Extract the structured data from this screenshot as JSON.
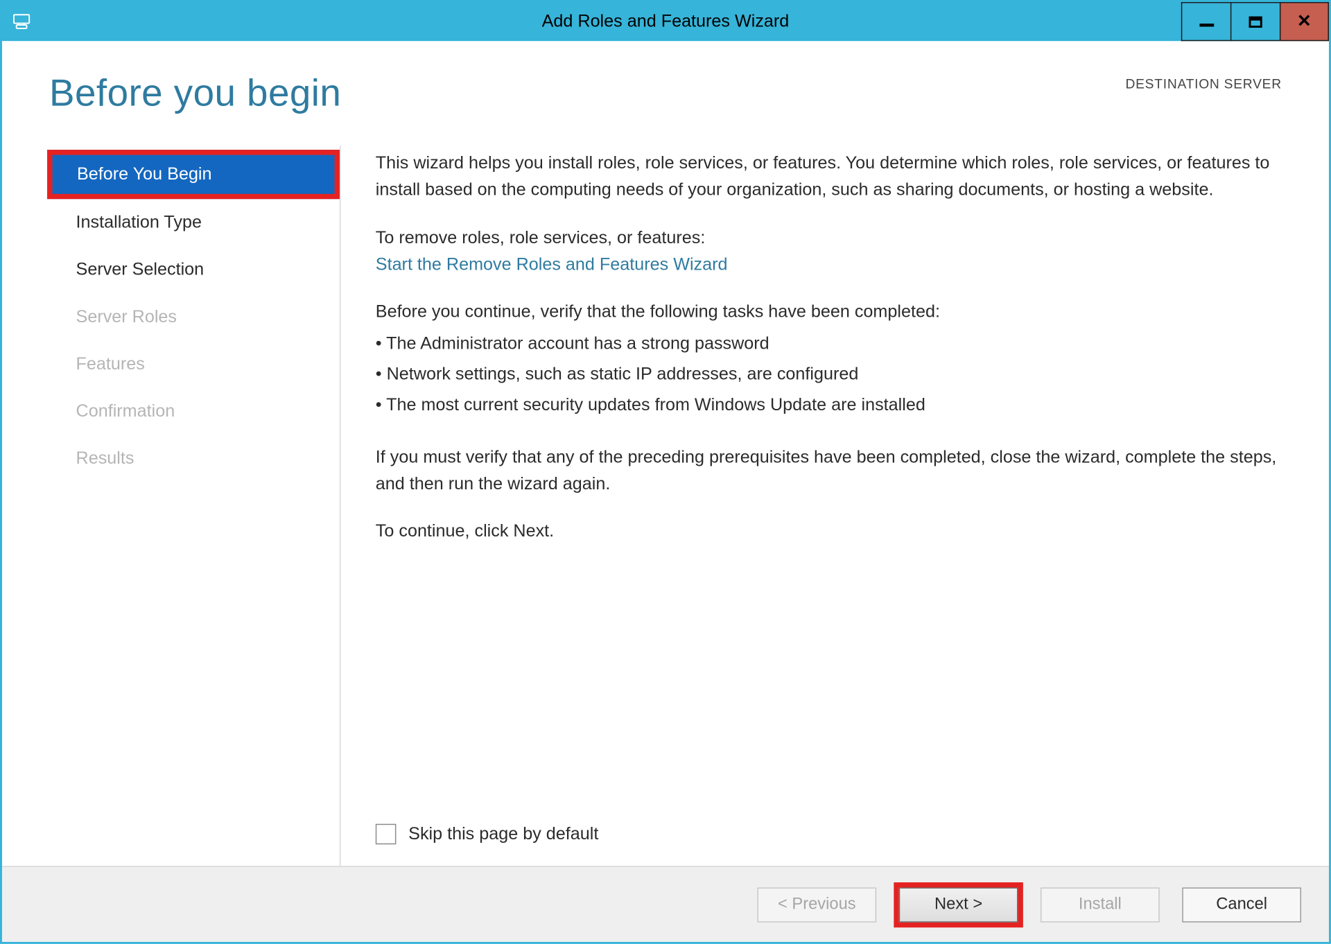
{
  "window": {
    "title": "Add Roles and Features Wizard"
  },
  "header": {
    "page_title": "Before you begin",
    "destination_label": "DESTINATION SERVER",
    "destination_name": " "
  },
  "sidebar": {
    "items": [
      {
        "label": "Before You Begin",
        "state": "selected"
      },
      {
        "label": "Installation Type",
        "state": "enabled"
      },
      {
        "label": "Server Selection",
        "state": "enabled"
      },
      {
        "label": "Server Roles",
        "state": "disabled"
      },
      {
        "label": "Features",
        "state": "disabled"
      },
      {
        "label": "Confirmation",
        "state": "disabled"
      },
      {
        "label": "Results",
        "state": "disabled"
      }
    ]
  },
  "content": {
    "intro": "This wizard helps you install roles, role services, or features. You determine which roles, role services, or features to install based on the computing needs of your organization, such as sharing documents, or hosting a website.",
    "remove_prompt": "To remove roles, role services, or features:",
    "remove_link": "Start the Remove Roles and Features Wizard",
    "verify_prompt": "Before you continue, verify that the following tasks have been completed:",
    "checklist": [
      "The Administrator account has a strong password",
      "Network settings, such as static IP addresses, are configured",
      "The most current security updates from Windows Update are installed"
    ],
    "close_note": "If you must verify that any of the preceding prerequisites have been completed, close the wizard, complete the steps, and then run the wizard again.",
    "continue_note": "To continue, click Next.",
    "skip_label": "Skip this page by default"
  },
  "footer": {
    "previous": "< Previous",
    "next": "Next >",
    "install": "Install",
    "cancel": "Cancel"
  }
}
